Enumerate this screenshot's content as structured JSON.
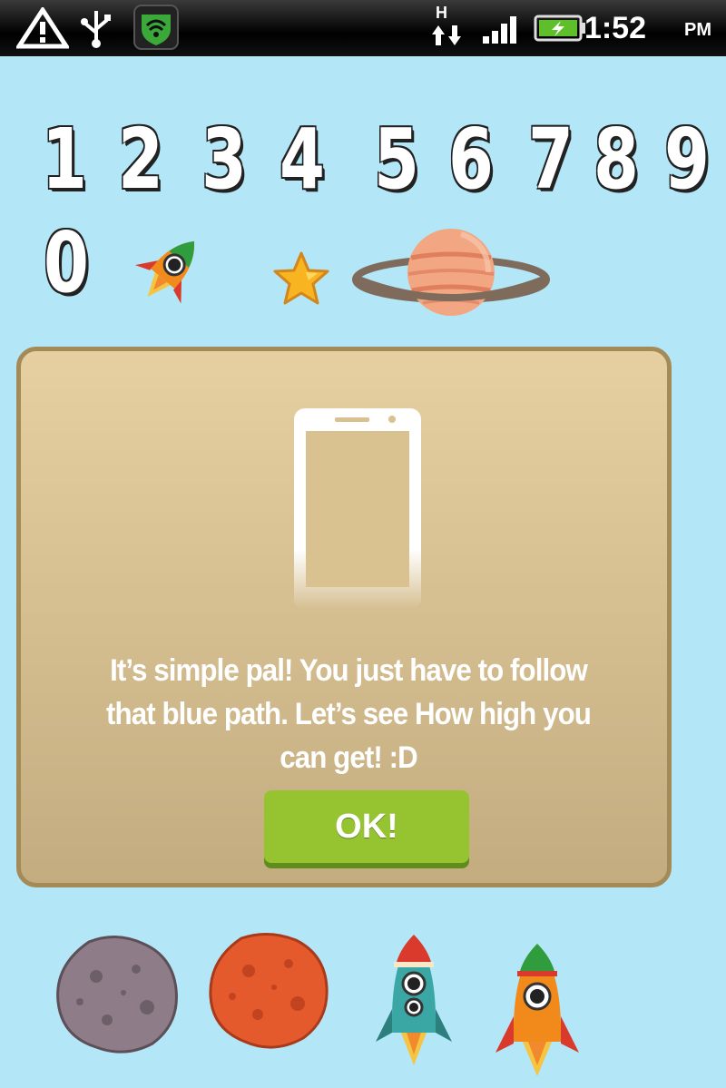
{
  "status_bar": {
    "time": "1:52",
    "ampm": "PM",
    "network_label": "H",
    "icons": [
      "warning-icon",
      "usb-icon",
      "lookout-shield-icon",
      "data-arrows-icon",
      "signal-icon",
      "battery-charging-icon"
    ]
  },
  "digits": [
    "1",
    "2",
    "3",
    "4",
    "5",
    "6",
    "7",
    "8",
    "9",
    "0"
  ],
  "sprites_top": [
    "rocket-small-icon",
    "star-icon",
    "ringed-planet-icon"
  ],
  "dialog": {
    "message": "It’s simple pal! You just have to follow that blue path. Let’s see How high you can get! :D",
    "ok_label": "OK!"
  },
  "sprites_bottom": [
    "gray-asteroid-icon",
    "red-asteroid-icon",
    "teal-rocket-icon",
    "orange-rocket-icon"
  ],
  "colors": {
    "background": "#b3e7f7",
    "dialog_fill": "#d8c393",
    "dialog_border": "#a48a57",
    "ok_button": "#96c431"
  }
}
